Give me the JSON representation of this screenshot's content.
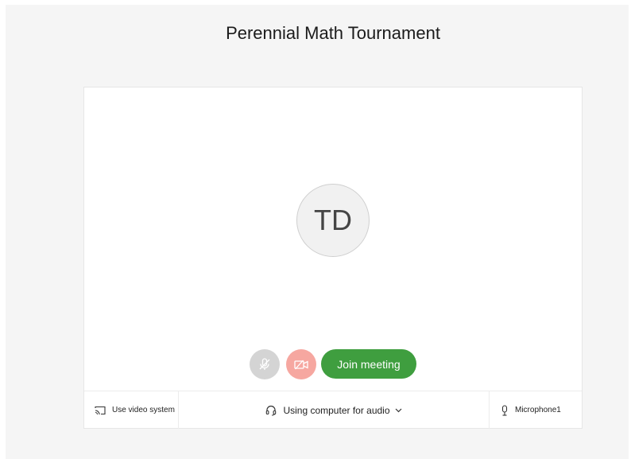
{
  "meeting": {
    "title": "Perennial Math Tournament"
  },
  "preview": {
    "avatar_initials": "TD"
  },
  "controls": {
    "mic_icon": "mic-muted-icon",
    "camera_icon": "camera-off-icon",
    "join_label": "Join meeting"
  },
  "bottom_bar": {
    "video_system_label": "Use video system",
    "audio_label": "Using computer for audio",
    "microphone_label": "Microphone1"
  },
  "colors": {
    "join_button": "#3f9e3f",
    "camera_off_button": "#f6a7a0",
    "mic_muted_button": "#d4d4d4",
    "page_background": "#f5f5f5"
  }
}
